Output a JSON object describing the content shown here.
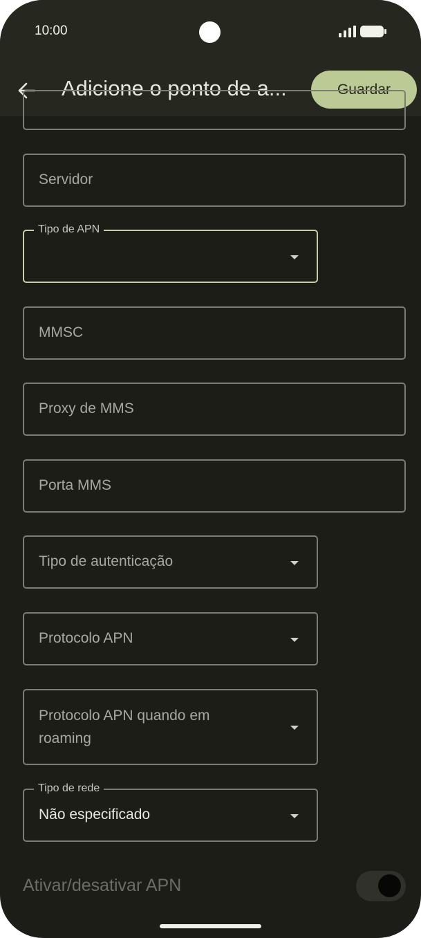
{
  "status_bar": {
    "time": "10:00"
  },
  "header": {
    "title": "Adicione o ponto de a...",
    "save_label": "Guardar"
  },
  "fields": {
    "servidor": {
      "placeholder": "Servidor"
    },
    "tipo_apn": {
      "label": "Tipo de APN",
      "value": ""
    },
    "mmsc": {
      "placeholder": "MMSC"
    },
    "proxy_mms": {
      "placeholder": "Proxy de MMS"
    },
    "porta_mms": {
      "placeholder": "Porta MMS"
    },
    "tipo_autenticacao": {
      "placeholder": "Tipo de autenticação"
    },
    "protocolo_apn": {
      "placeholder": "Protocolo APN"
    },
    "protocolo_roaming": {
      "placeholder_line1": "Protocolo APN quando em",
      "placeholder_line2": "roaming"
    },
    "tipo_rede": {
      "label": "Tipo de rede",
      "value": "Não especificado"
    }
  },
  "toggle": {
    "label": "Ativar/desativar APN",
    "enabled": false
  },
  "colors": {
    "background": "#1c1d17",
    "accent": "#bccb95",
    "focus_border": "#c4d0a5"
  },
  "icons": {
    "back": "arrow-left-icon",
    "dropdown": "dropdown-arrow-icon",
    "signal": "signal-icon",
    "battery": "battery-icon"
  }
}
